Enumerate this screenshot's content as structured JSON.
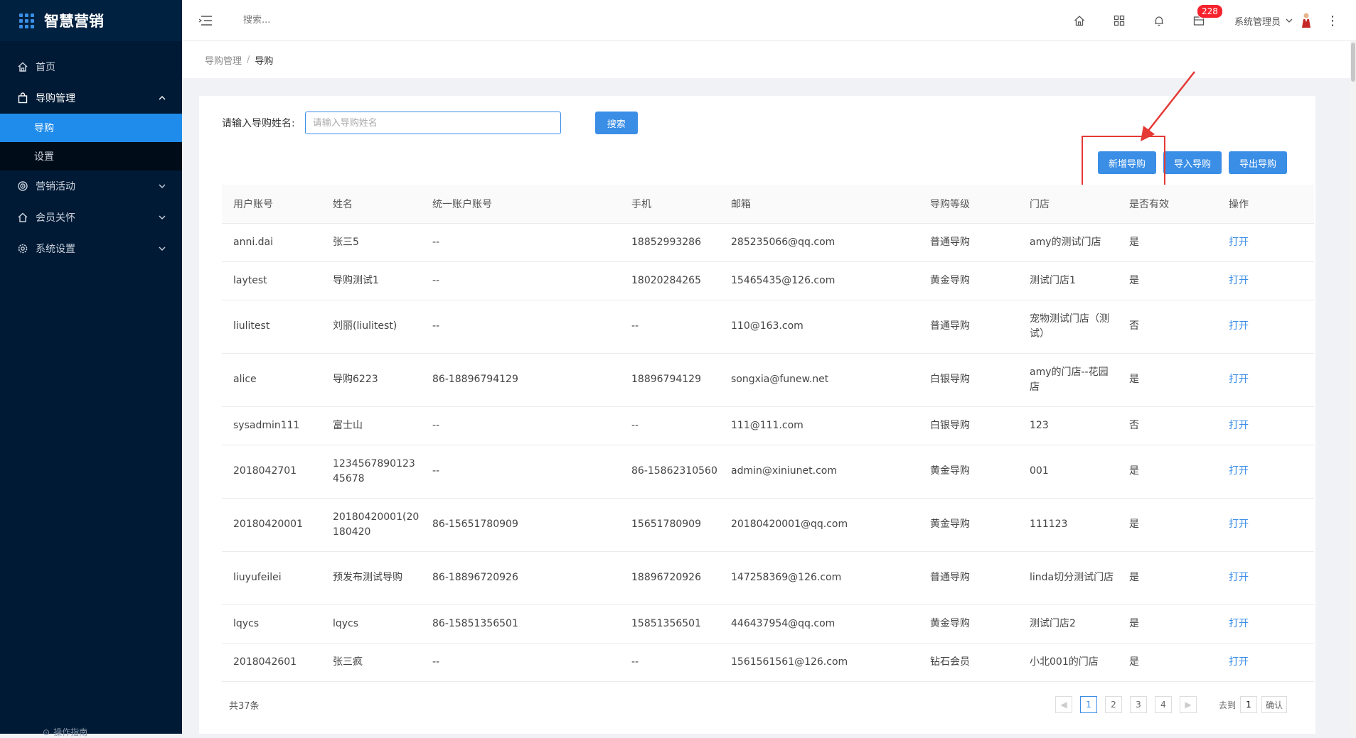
{
  "app": {
    "title": "智慧营销"
  },
  "sidebar": {
    "items": [
      {
        "label": "首页",
        "icon": "home-icon"
      },
      {
        "label": "导购管理",
        "icon": "bag-icon"
      },
      {
        "label": "营销活动",
        "icon": "target-icon"
      },
      {
        "label": "会员关怀",
        "icon": "house-icon"
      },
      {
        "label": "系统设置",
        "icon": "settings-icon"
      }
    ],
    "submenu": [
      {
        "label": "导购",
        "active": true
      },
      {
        "label": "设置",
        "active": false
      }
    ],
    "bottom_label": "操作指南"
  },
  "header": {
    "search_placeholder": "搜索...",
    "notification_count": "228",
    "user_name": "系统管理员"
  },
  "breadcrumb": {
    "parent": "导购管理",
    "separator": "/",
    "current": "导购"
  },
  "filter": {
    "label": "请输入导购姓名:",
    "placeholder": "请输入导购姓名",
    "search_button": "搜索"
  },
  "actions": {
    "add": "新增导购",
    "import": "导入导购",
    "export": "导出导购"
  },
  "table": {
    "headers": [
      "用户账号",
      "姓名",
      "统一账户账号",
      "手机",
      "邮箱",
      "导购等级",
      "门店",
      "是否有效",
      "操作"
    ],
    "rows": [
      {
        "account": "anni.dai",
        "name": "张三5",
        "unified": "--",
        "phone": "18852993286",
        "email": "285235066@qq.com",
        "level": "普通导购",
        "store": "amy的测试门店",
        "valid": "是",
        "op": "打开"
      },
      {
        "account": "laytest",
        "name": "导购测试1",
        "unified": "--",
        "phone": "18020284265",
        "email": "15465435@126.com",
        "level": "黄金导购",
        "store": "测试门店1",
        "valid": "是",
        "op": "打开"
      },
      {
        "account": "liulitest",
        "name": "刘丽(liulitest)",
        "unified": "--",
        "phone": "--",
        "email": "110@163.com",
        "level": "普通导购",
        "store": "宠物测试门店（测试）",
        "valid": "否",
        "op": "打开"
      },
      {
        "account": "alice",
        "name": "导购6223",
        "unified": "86-18896794129",
        "phone": "18896794129",
        "email": "songxia@funew.net",
        "level": "白银导购",
        "store": "amy的门店--花园店",
        "valid": "是",
        "op": "打开"
      },
      {
        "account": "sysadmin111",
        "name": "富士山",
        "unified": "--",
        "phone": "--",
        "email": "111@111.com",
        "level": "白银导购",
        "store": "123",
        "valid": "否",
        "op": "打开"
      },
      {
        "account": "2018042701",
        "name": "123456789012345678",
        "unified": "--",
        "phone": "86-15862310560",
        "email": "admin@xiniunet.com",
        "level": "黄金导购",
        "store": "001",
        "valid": "是",
        "op": "打开"
      },
      {
        "account": "20180420001",
        "name": "20180420001(20180420",
        "unified": "86-15651780909",
        "phone": "15651780909",
        "email": "20180420001@qq.com",
        "level": "黄金导购",
        "store": "111123",
        "valid": "是",
        "op": "打开"
      },
      {
        "account": "liuyufeilei",
        "name": "预发布测试导购",
        "unified": "86-18896720926",
        "phone": "18896720926",
        "email": "147258369@126.com",
        "level": "普通导购",
        "store": "linda切分测试门店",
        "valid": "是",
        "op": "打开"
      },
      {
        "account": "lqycs",
        "name": "lqycs",
        "unified": "86-15851356501",
        "phone": "15851356501",
        "email": "446437954@qq.com",
        "level": "黄金导购",
        "store": "测试门店2",
        "valid": "是",
        "op": "打开"
      },
      {
        "account": "2018042601",
        "name": "张三疯",
        "unified": "--",
        "phone": "--",
        "email": "1561561561@126.com",
        "level": "钻石会员",
        "store": "小北001的门店",
        "valid": "是",
        "op": "打开"
      }
    ]
  },
  "footer": {
    "total": "共37条",
    "pages": [
      "1",
      "2",
      "3",
      "4"
    ],
    "goto_label": "去到",
    "goto_value": "1",
    "confirm": "确认"
  },
  "colors": {
    "sidebar_bg": "#001a35",
    "accent": "#3a8ee6",
    "badge": "#f5222d",
    "highlight": "#e53935"
  }
}
